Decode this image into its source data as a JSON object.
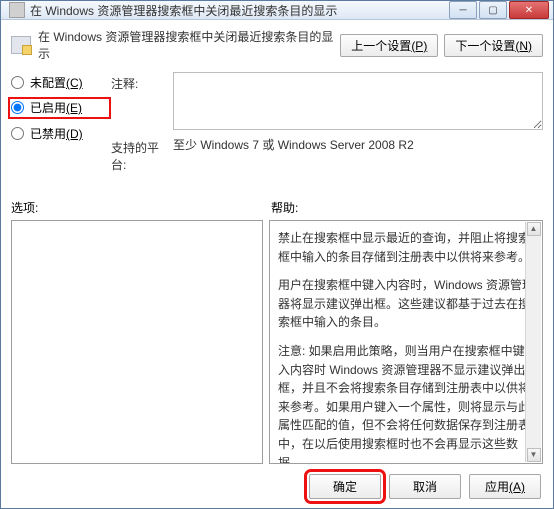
{
  "titlebar": {
    "text": "在 Windows 资源管理器搜索框中关闭最近搜索条目的显示"
  },
  "header": {
    "text": "在 Windows 资源管理器搜索框中关闭最近搜索条目的显示",
    "prev_btn": "上一个设置",
    "prev_key": "(P)",
    "next_btn": "下一个设置",
    "next_key": "(N)"
  },
  "radios": {
    "not_configured": "未配置",
    "not_configured_key": "(C)",
    "enabled": "已启用",
    "enabled_key": "(E)",
    "disabled": "已禁用",
    "disabled_key": "(D)",
    "selected": "enabled"
  },
  "fields": {
    "comment_label": "注释:",
    "platform_label": "支持的平台:",
    "platform_value": "至少 Windows 7 或 Windows Server 2008 R2"
  },
  "sections": {
    "options_label": "选项:",
    "help_label": "帮助:"
  },
  "help": {
    "p1": "禁止在搜索框中显示最近的查询，并阻止将搜索框中输入的条目存储到注册表中以供将来参考。",
    "p2": "用户在搜索框中键入内容时，Windows 资源管理器将显示建议弹出框。这些建议都基于过去在搜索框中输入的条目。",
    "p3": "注意: 如果启用此策略，则当用户在搜索框中键入内容时 Windows 资源管理器不显示建议弹出框，并且不会将搜索条目存储到注册表中以供将来参考。如果用户键入一个属性，则将显示与此属性匹配的值，但不会将任何数据保存到注册表中，在以后使用搜索框时也不会再显示这些数据。"
  },
  "footer": {
    "ok": "确定",
    "cancel": "取消",
    "apply": "应用",
    "apply_key": "(A)"
  }
}
